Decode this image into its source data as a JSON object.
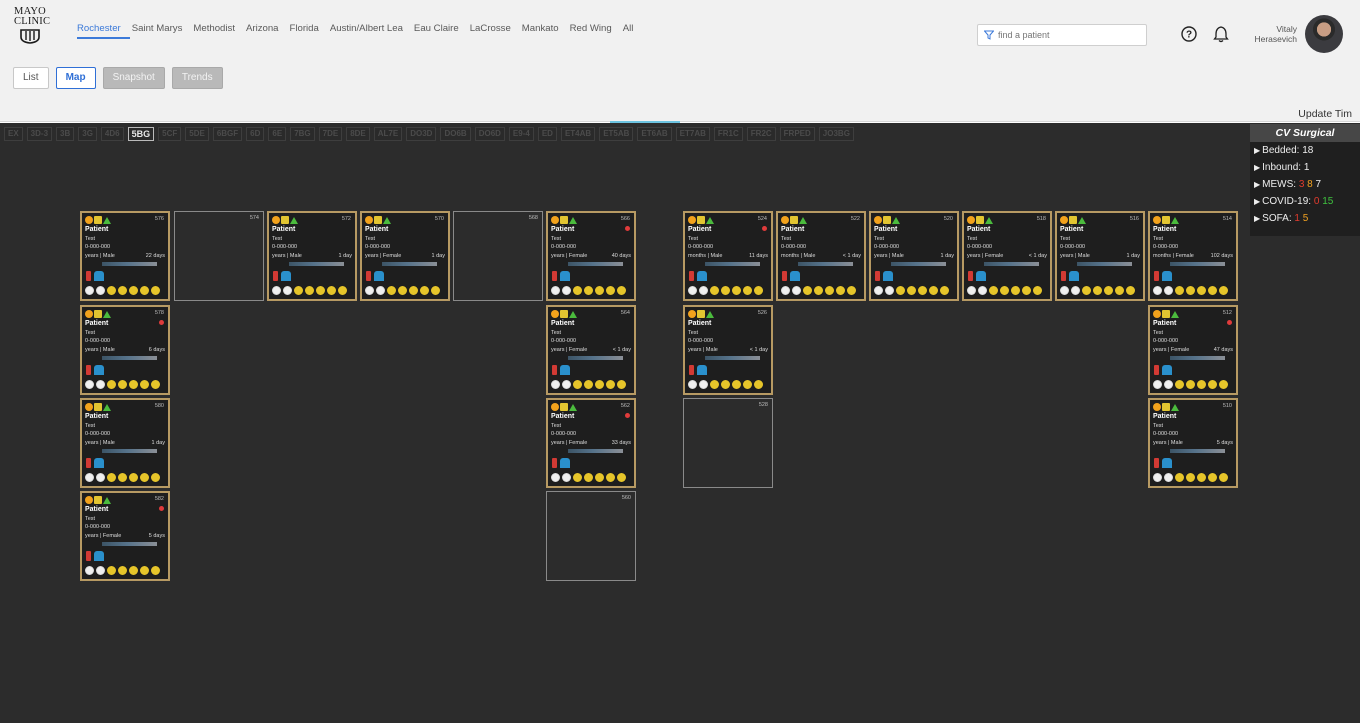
{
  "logo": {
    "line1": "MAYO",
    "line2": "CLINIC"
  },
  "locations": [
    "Rochester",
    "Saint Marys",
    "Methodist",
    "Arizona",
    "Florida",
    "Austin/Albert Lea",
    "Eau Claire",
    "LaCrosse",
    "Mankato",
    "Red Wing",
    "All"
  ],
  "active_location": "Rochester",
  "search": {
    "placeholder": "find a patient"
  },
  "user": {
    "first": "Vitaly",
    "last": "Herasevich"
  },
  "views": {
    "list": "List",
    "map": "Map",
    "snapshot": "Snapshot",
    "trends": "Trends"
  },
  "update_text": "Update Tim",
  "units": [
    "EX",
    "3D-3",
    "3B",
    "3G",
    "4D6",
    "5BG",
    "5CF",
    "5DE",
    "6BGF",
    "6D",
    "6E",
    "7BG",
    "7DE",
    "8DE",
    "AL7E",
    "DO3D",
    "DO6B",
    "DO6D",
    "E9-4",
    "ED",
    "ET4AB",
    "ET5AB",
    "ET6AB",
    "ET7AB",
    "FR1C",
    "FR2C",
    "FRPED",
    "JO3BG"
  ],
  "selected_unit": "5BG",
  "panel": {
    "title": "CV Surgical",
    "bedded": "Bedded: 18",
    "inbound": "Inbound: 1",
    "mews_label": "MEWS:",
    "mews": [
      "3",
      "8",
      "7"
    ],
    "covid_label": "COVID-19:",
    "covid": [
      "0",
      "15"
    ],
    "sofa_label": "SOFA:",
    "sofa": [
      "1",
      "5"
    ]
  },
  "colors": {
    "header_bg": "#f1f1f1",
    "map_bg": "#2c2c2c",
    "tile_border": "#b79a63",
    "accent": "#3c7ad9"
  },
  "beds": [
    {
      "num": "576",
      "status": "occupied",
      "name": "Patient",
      "test": "Test",
      "mrn": "0-000-000",
      "info": "years | Male",
      "los": "22 days"
    },
    {
      "num": "574",
      "status": "empty"
    },
    {
      "num": "572",
      "status": "occupied",
      "name": "Patient",
      "test": "Test",
      "mrn": "0-000-000",
      "info": "years | Male",
      "los": "1 day"
    },
    {
      "num": "570",
      "status": "occupied",
      "name": "Patient",
      "test": "Test",
      "mrn": "0-000-000",
      "info": "years | Female",
      "los": "1 day"
    },
    {
      "num": "568",
      "status": "empty"
    },
    {
      "num": "566",
      "status": "occupied",
      "name": "Patient",
      "test": "Test",
      "mrn": "0-000-000",
      "info": "years | Female",
      "los": "40 days"
    },
    {
      "num": "524",
      "status": "occupied",
      "name": "Patient",
      "test": "Test",
      "mrn": "0-000-000",
      "info": "months | Male",
      "los": "11 days"
    },
    {
      "num": "522",
      "status": "occupied",
      "name": "Patient",
      "test": "Test",
      "mrn": "0-000-000",
      "info": "months | Male",
      "los": "< 1 day"
    },
    {
      "num": "520",
      "status": "occupied",
      "name": "Patient",
      "test": "Test",
      "mrn": "0-000-000",
      "info": "years | Male",
      "los": "1 day"
    },
    {
      "num": "518",
      "status": "occupied",
      "name": "Patient",
      "test": "Test",
      "mrn": "0-000-000",
      "info": "years | Female",
      "los": "< 1 day"
    },
    {
      "num": "516",
      "status": "occupied",
      "name": "Patient",
      "test": "Test",
      "mrn": "0-000-000",
      "info": "years | Male",
      "los": "1 day"
    },
    {
      "num": "514",
      "status": "occupied",
      "name": "Patient",
      "test": "Test",
      "mrn": "0-000-000",
      "info": "months | Female",
      "los": "102 days"
    },
    {
      "num": "578",
      "status": "occupied",
      "name": "Patient",
      "test": "Test",
      "mrn": "0-000-000",
      "info": "years | Male",
      "los": "6 days"
    },
    {
      "num": "564",
      "status": "occupied",
      "name": "Patient",
      "test": "Test",
      "mrn": "0-000-000",
      "info": "years | Female",
      "los": "< 1 day"
    },
    {
      "num": "526",
      "status": "occupied",
      "name": "Patient",
      "test": "Test",
      "mrn": "0-000-000",
      "info": "years | Male",
      "los": "< 1 day"
    },
    {
      "num": "512",
      "status": "occupied",
      "name": "Patient",
      "test": "Test",
      "mrn": "0-000-000",
      "info": "years | Female",
      "los": "47 days"
    },
    {
      "num": "580",
      "status": "occupied",
      "name": "Patient",
      "test": "Test",
      "mrn": "0-000-000",
      "info": "years | Male",
      "los": "1 day"
    },
    {
      "num": "562",
      "status": "occupied",
      "name": "Patient",
      "test": "Test",
      "mrn": "0-000-000",
      "info": "years | Female",
      "los": "33 days"
    },
    {
      "num": "528",
      "status": "empty"
    },
    {
      "num": "510",
      "status": "occupied",
      "name": "Patient",
      "test": "Test",
      "mrn": "0-000-000",
      "info": "years | Male",
      "los": "5 days"
    },
    {
      "num": "582",
      "status": "occupied",
      "name": "Patient",
      "test": "Test",
      "mrn": "0-000-000",
      "info": "years | Female",
      "los": "5 days"
    },
    {
      "num": "560",
      "status": "empty"
    }
  ]
}
